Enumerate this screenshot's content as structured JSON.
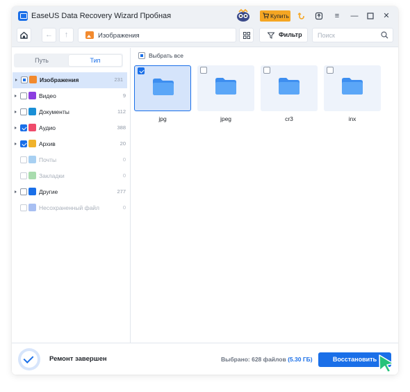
{
  "window": {
    "title": "EaseUS Data Recovery Wizard Пробная"
  },
  "titlebar": {
    "buy_label": "Купить",
    "icons": [
      "mascot-icon",
      "cart-icon",
      "rewind-icon",
      "export-icon",
      "menu-icon",
      "minimize-icon",
      "maximize-icon",
      "close-icon"
    ]
  },
  "toolbar": {
    "breadcrumb_label": "Изображения",
    "filter_label": "Фильтр",
    "search_placeholder": "Поиск"
  },
  "sidebar": {
    "tabs": [
      {
        "label": "Путь",
        "active": false
      },
      {
        "label": "Тип",
        "active": true
      }
    ],
    "items": [
      {
        "label": "Изображения",
        "count": "231",
        "state": "partial",
        "expandable": true,
        "selected": true,
        "icon": "images-icon",
        "color": "#f28a2e"
      },
      {
        "label": "Видео",
        "count": "9",
        "state": "unchecked",
        "expandable": true,
        "selected": false,
        "icon": "video-icon",
        "color": "#8b3ee0"
      },
      {
        "label": "Документы",
        "count": "112",
        "state": "unchecked",
        "expandable": true,
        "selected": false,
        "icon": "documents-icon",
        "color": "#1a8fd6"
      },
      {
        "label": "Аудио",
        "count": "388",
        "state": "checked",
        "expandable": true,
        "selected": false,
        "icon": "audio-icon",
        "color": "#ef4b6b"
      },
      {
        "label": "Архив",
        "count": "20",
        "state": "checked",
        "expandable": true,
        "selected": false,
        "icon": "archive-icon",
        "color": "#f0b22b"
      },
      {
        "label": "Почты",
        "count": "0",
        "state": "unchecked",
        "expandable": false,
        "selected": false,
        "disabled": true,
        "icon": "mail-icon",
        "color": "#a8d0f2"
      },
      {
        "label": "Закладки",
        "count": "0",
        "state": "unchecked",
        "expandable": false,
        "selected": false,
        "disabled": true,
        "icon": "bookmark-icon",
        "color": "#a9dcae"
      },
      {
        "label": "Другие",
        "count": "277",
        "state": "unchecked",
        "expandable": true,
        "selected": false,
        "icon": "other-files-icon",
        "color": "#1a6fe8"
      },
      {
        "label": "Несохраненный файл",
        "count": "0",
        "state": "unchecked",
        "expandable": false,
        "selected": false,
        "disabled": true,
        "icon": "unsaved-file-icon",
        "color": "#a8bff2"
      }
    ]
  },
  "content": {
    "select_all_label": "Выбрать все",
    "folders": [
      {
        "name": "jpg",
        "checked": true
      },
      {
        "name": "jpeg",
        "checked": false
      },
      {
        "name": "cr3",
        "checked": false
      },
      {
        "name": "inx",
        "checked": false
      }
    ],
    "folder_color": "#4b9bf5"
  },
  "footer": {
    "status_label": "Ремонт завершен",
    "selected_prefix": "Выбрано: 628 файлов ",
    "selected_size": "(5.30 ГБ)",
    "restore_label": "Восстановить"
  },
  "colors": {
    "accent": "#1a6fe8",
    "buy_button": "#f5a623",
    "cursor": "#27c27a"
  }
}
